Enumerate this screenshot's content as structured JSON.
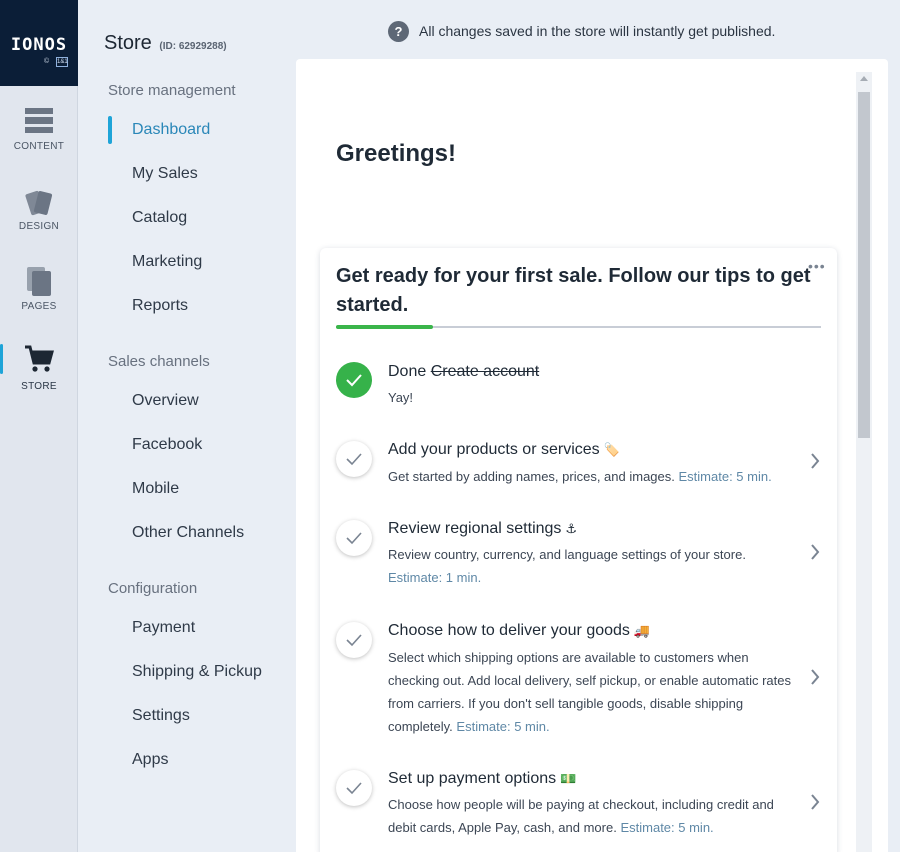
{
  "logo": {
    "text": "IONOS",
    "sub": "©",
    "badge": "1&1"
  },
  "rail": [
    {
      "id": "content",
      "label": "CONTENT",
      "icon": "content-icon"
    },
    {
      "id": "design",
      "label": "DESIGN",
      "icon": "design-icon"
    },
    {
      "id": "pages",
      "label": "PAGES",
      "icon": "pages-icon"
    },
    {
      "id": "store",
      "label": "STORE",
      "icon": "cart-icon",
      "active": true
    }
  ],
  "nav": {
    "title": "Store",
    "store_id": "(ID: 62929288)",
    "sections": [
      {
        "label": "Store management",
        "items": [
          "Dashboard",
          "My Sales",
          "Catalog",
          "Marketing",
          "Reports"
        ]
      },
      {
        "label": "Sales channels",
        "items": [
          "Overview",
          "Facebook",
          "Mobile",
          "Other Channels"
        ]
      },
      {
        "label": "Configuration",
        "items": [
          "Payment",
          "Shipping & Pickup",
          "Settings",
          "Apps"
        ]
      }
    ],
    "active_item": "Dashboard"
  },
  "top_message": "All changes saved in the store will instantly get published.",
  "greeting": "Greetings!",
  "card": {
    "title": "Get ready for your first sale. Follow our tips to get started.",
    "menu": "•••",
    "progress": 0.2,
    "steps": [
      {
        "title_prefix": "Done",
        "title": "Create account",
        "desc": "Yay!",
        "estimate": "",
        "done": true,
        "emoji": ""
      },
      {
        "title": "Add your products or services",
        "emoji": "🏷️",
        "desc": "Get started by adding names, prices, and images.",
        "estimate": "Estimate: 5 min.",
        "done": false
      },
      {
        "title": "Review regional settings",
        "emoji": "⚓",
        "desc": "Review country, currency, and language settings of your store.",
        "estimate": "Estimate: 1 min.",
        "done": false
      },
      {
        "title": "Choose how to deliver your goods",
        "emoji": "🚚",
        "desc": "Select which shipping options are available to customers when checking out. Add local delivery, self pickup, or enable automatic rates from carriers. If you don't sell tangible goods, disable shipping completely.",
        "estimate": "Estimate: 5 min.",
        "done": false
      },
      {
        "title": "Set up payment options",
        "emoji": "💵",
        "desc": "Choose how people will be paying at checkout, including credit and debit cards, Apple Pay, cash, and more.",
        "estimate": "Estimate: 5 min.",
        "done": false
      }
    ]
  },
  "colors": {
    "accent": "#1ea4d8",
    "success": "#36b24a",
    "logo_bg": "#0b1e37"
  }
}
